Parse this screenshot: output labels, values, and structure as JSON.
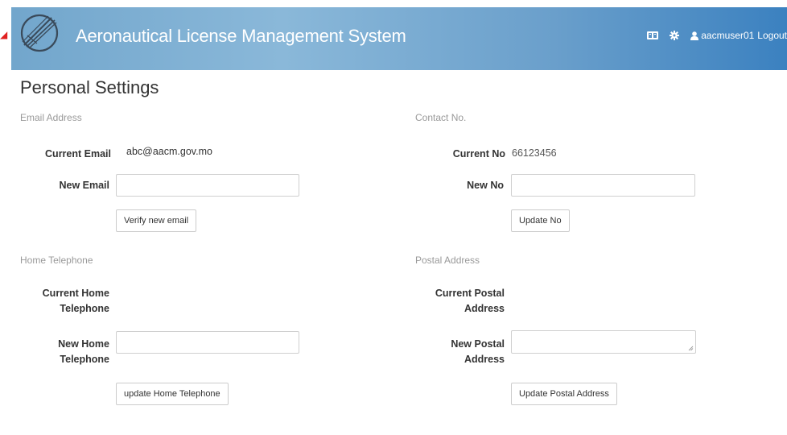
{
  "header": {
    "title": "Aeronautical License Management System",
    "username": "aacmuser01",
    "logout_label": "Logout",
    "icons": [
      "language-icon",
      "gear-icon",
      "user-icon"
    ],
    "colors": {
      "header_start": "#72a6cc",
      "header_end": "#3b81c0"
    }
  },
  "page": {
    "title": "Personal Settings"
  },
  "email": {
    "section_title": "Email Address",
    "current_label": "Current Email",
    "current_value": "abc@aacm.gov.mo",
    "new_label": "New Email",
    "new_value": "",
    "button_label": "Verify new email"
  },
  "contact": {
    "section_title": "Contact No.",
    "current_label": "Current No",
    "current_value": "66123456",
    "new_label": "New No",
    "new_value": "",
    "button_label": "Update No"
  },
  "home_phone": {
    "section_title": "Home Telephone",
    "current_label_line1": "Current Home",
    "current_label_line2": "Telephone",
    "current_value": "",
    "new_label_line1": "New Home",
    "new_label_line2": "Telephone",
    "new_value": "",
    "button_label": "update Home Telephone"
  },
  "postal": {
    "section_title": "Postal Address",
    "current_label_line1": "Current Postal",
    "current_label_line2": "Address",
    "current_value": "",
    "new_label_line1": "New Postal",
    "new_label_line2": "Address",
    "new_value": "",
    "button_label": "Update Postal Address"
  }
}
